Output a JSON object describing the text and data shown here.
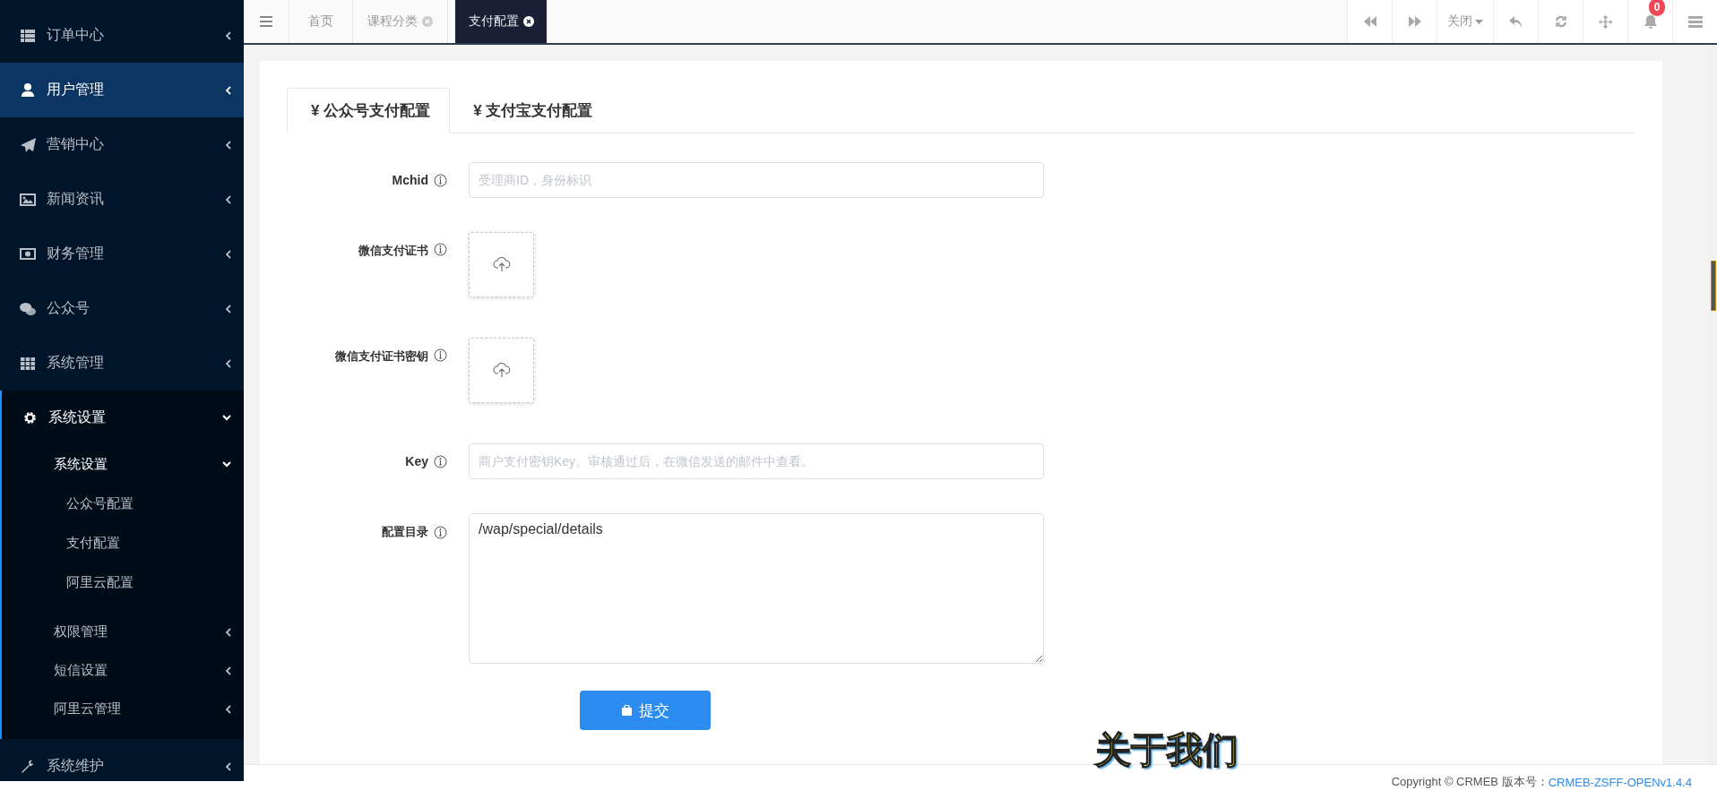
{
  "sidebar": {
    "items": [
      {
        "label": "订单中心",
        "selected": false,
        "expanded": false
      },
      {
        "label": "用户管理",
        "selected": true,
        "expanded": false
      },
      {
        "label": "营销中心",
        "selected": false,
        "expanded": false
      },
      {
        "label": "新闻资讯",
        "selected": false,
        "expanded": false
      },
      {
        "label": "财务管理",
        "selected": false,
        "expanded": false
      },
      {
        "label": "公众号",
        "selected": false,
        "expanded": false
      },
      {
        "label": "系统管理",
        "selected": false,
        "expanded": false
      },
      {
        "label": "系统设置",
        "selected": false,
        "expanded": true,
        "children": [
          {
            "label": "系统设置",
            "expanded": true,
            "children": [
              {
                "label": "公众号配置",
                "selected": false
              },
              {
                "label": "支付配置",
                "selected": false
              },
              {
                "label": "阿里云配置",
                "selected": false
              }
            ]
          },
          {
            "label": "权限管理",
            "expanded": false
          },
          {
            "label": "短信设置",
            "expanded": false
          },
          {
            "label": "阿里云管理",
            "expanded": false
          }
        ]
      },
      {
        "label": "系统维护",
        "selected": false,
        "expanded": false
      }
    ]
  },
  "tabs": [
    {
      "label": "首页",
      "selected": false,
      "closable": false
    },
    {
      "label": "课程分类",
      "selected": false,
      "closable": true
    },
    {
      "label": "支付配置",
      "selected": true,
      "closable": true
    }
  ],
  "toolbar": {
    "close_menu": "关闭",
    "notification_count": "0"
  },
  "form": {
    "tabs": [
      {
        "label": "¥ 公众号支付配置",
        "selected": true
      },
      {
        "label": "¥ 支付宝支付配置",
        "selected": false
      }
    ],
    "fields": [
      {
        "kind": "input",
        "label": "Mchid",
        "placeholder": "受理商ID，身份标识"
      },
      {
        "kind": "upload",
        "label": "微信支付证书"
      },
      {
        "kind": "upload",
        "label": "微信支付证书密钥"
      },
      {
        "kind": "input",
        "label": "Key",
        "placeholder": "商户支付密钥Key。审核通过后，在微信发送的邮件中查看。"
      },
      {
        "kind": "textarea",
        "label": "配置目录",
        "value": "/wap/special/details"
      }
    ],
    "submit": "提交"
  },
  "floating_text": "关于我们",
  "footer": {
    "copyright": "Copyright © CRMEB 版本号：",
    "version_link": "CRMEB-ZSFF-OPENv1.4.4"
  }
}
